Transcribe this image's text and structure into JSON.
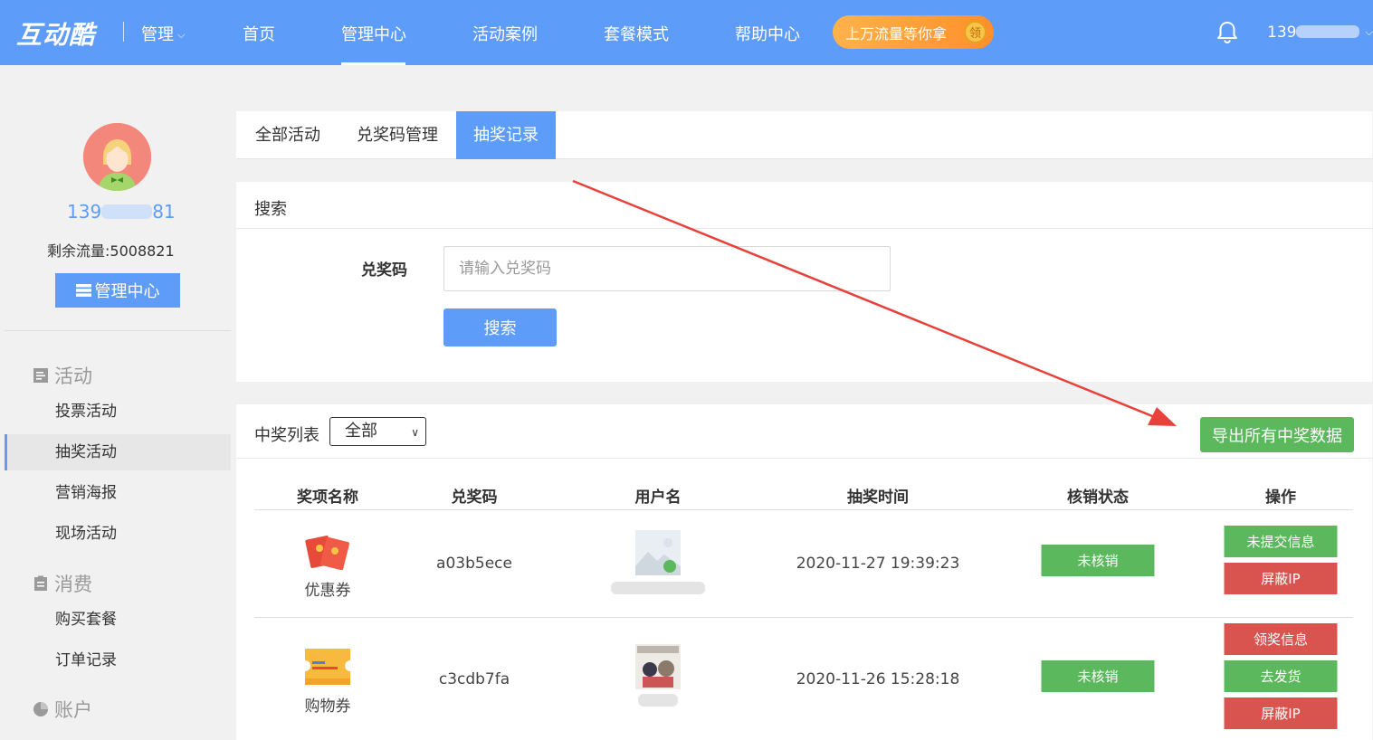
{
  "topnav": {
    "logo": "互动酷",
    "manage": "管理",
    "items": [
      "首页",
      "管理中心",
      "活动案例",
      "套餐模式",
      "帮助中心"
    ],
    "promo_text": "上万流量等你拿",
    "promo_badge": "领",
    "user_prefix": "139"
  },
  "sidebar": {
    "phone_prefix": "139",
    "phone_suffix": "81",
    "flow_label": "剩余流量:",
    "flow_value": "5008821",
    "center_button": "管理中心",
    "sections": [
      {
        "title": "活动",
        "items": [
          "投票活动",
          "抽奖活动",
          "营销海报",
          "现场活动"
        ]
      },
      {
        "title": "消费",
        "items": [
          "购买套餐",
          "订单记录"
        ]
      },
      {
        "title": "账户",
        "items": []
      }
    ],
    "active_item": "抽奖活动"
  },
  "tabs": [
    "全部活动",
    "兑奖码管理",
    "抽奖记录"
  ],
  "active_tab": "抽奖记录",
  "search": {
    "title": "搜索",
    "code_label": "兑奖码",
    "code_placeholder": "请输入兑奖码",
    "button": "搜索"
  },
  "list": {
    "label": "中奖列表",
    "filter": "全部",
    "export_button": "导出所有中奖数据",
    "headers": [
      "奖项名称",
      "兑奖码",
      "用户名",
      "抽奖时间",
      "核销状态",
      "操作"
    ],
    "rows": [
      {
        "prize": "优惠券",
        "prize_icon": "red-envelope-icon",
        "code": "a03b5ece",
        "time": "2020-11-27 19:39:23",
        "status": "未核销",
        "actions": [
          {
            "label": "未提交信息",
            "color": "#5cb85c"
          },
          {
            "label": "屏蔽IP",
            "color": "#d9534f"
          }
        ]
      },
      {
        "prize": "购物券",
        "prize_icon": "ticket-icon",
        "code": "c3cdb7fa",
        "time": "2020-11-26 15:28:18",
        "status": "未核销",
        "actions": [
          {
            "label": "领奖信息",
            "color": "#d9534f"
          },
          {
            "label": "去发货",
            "color": "#5cb85c"
          },
          {
            "label": "屏蔽IP",
            "color": "#d9534f"
          }
        ]
      }
    ]
  },
  "colors": {
    "primary": "#5d9cf8",
    "success": "#5cb85c",
    "danger": "#d9534f",
    "promo": "#ff9a33",
    "annotation_arrow": "#e8403a"
  }
}
